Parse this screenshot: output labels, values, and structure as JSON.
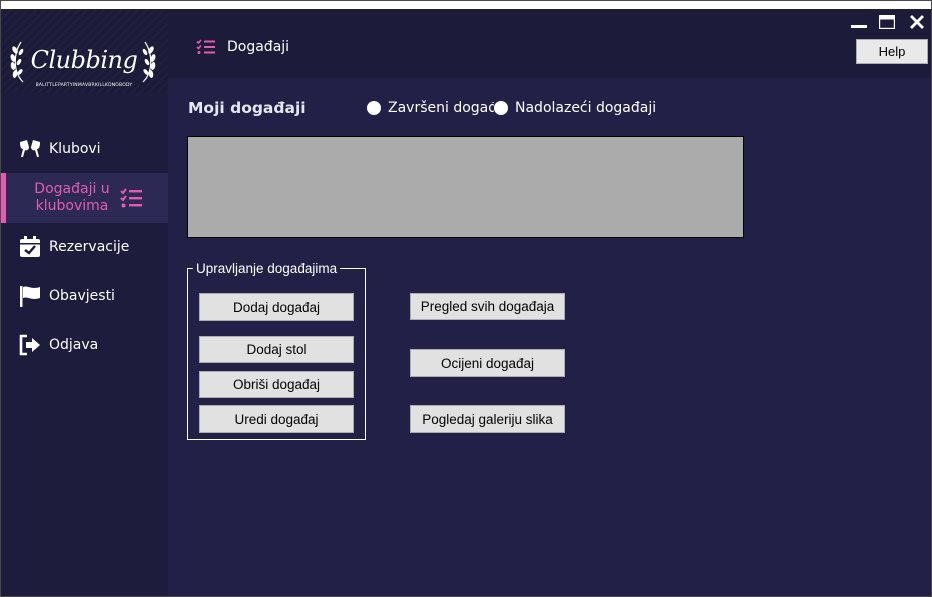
{
  "logo": {
    "name": "Clubbing",
    "tagline": "BALITTLEPARTYINMAVBRKILLKDNOBODY"
  },
  "sidebar": {
    "items": [
      {
        "label": "Klubovi",
        "icon": "glasses-icon"
      },
      {
        "label": "Događaji u klubovima",
        "icon": "list-check-icon"
      },
      {
        "label": "Rezervacije",
        "icon": "calendar-check-icon"
      },
      {
        "label": "Obavjesti",
        "icon": "flag-icon"
      },
      {
        "label": "Odjava",
        "icon": "sign-out-icon"
      }
    ],
    "active_index": 1
  },
  "header": {
    "title": "Događaji",
    "help_label": "Help"
  },
  "main": {
    "section_title": "Moji događaji",
    "radio_finished": "Završeni događaji",
    "radio_upcoming": "Nadolazeći događaji"
  },
  "group": {
    "legend": "Upravljanje događajima",
    "add_event": "Dodaj događaj",
    "add_table": "Dodaj stol",
    "delete_event": "Obriši događaj",
    "edit_event": "Uredi događaj"
  },
  "actions": {
    "view_all": "Pregled svih događaja",
    "rate_event": "Ocijeni događaj",
    "gallery": "Pogledaj galeriju slika"
  },
  "colors": {
    "sidebar_bg": "#1e1c3d",
    "main_bg": "#222047",
    "accent": "#e25cb0"
  }
}
